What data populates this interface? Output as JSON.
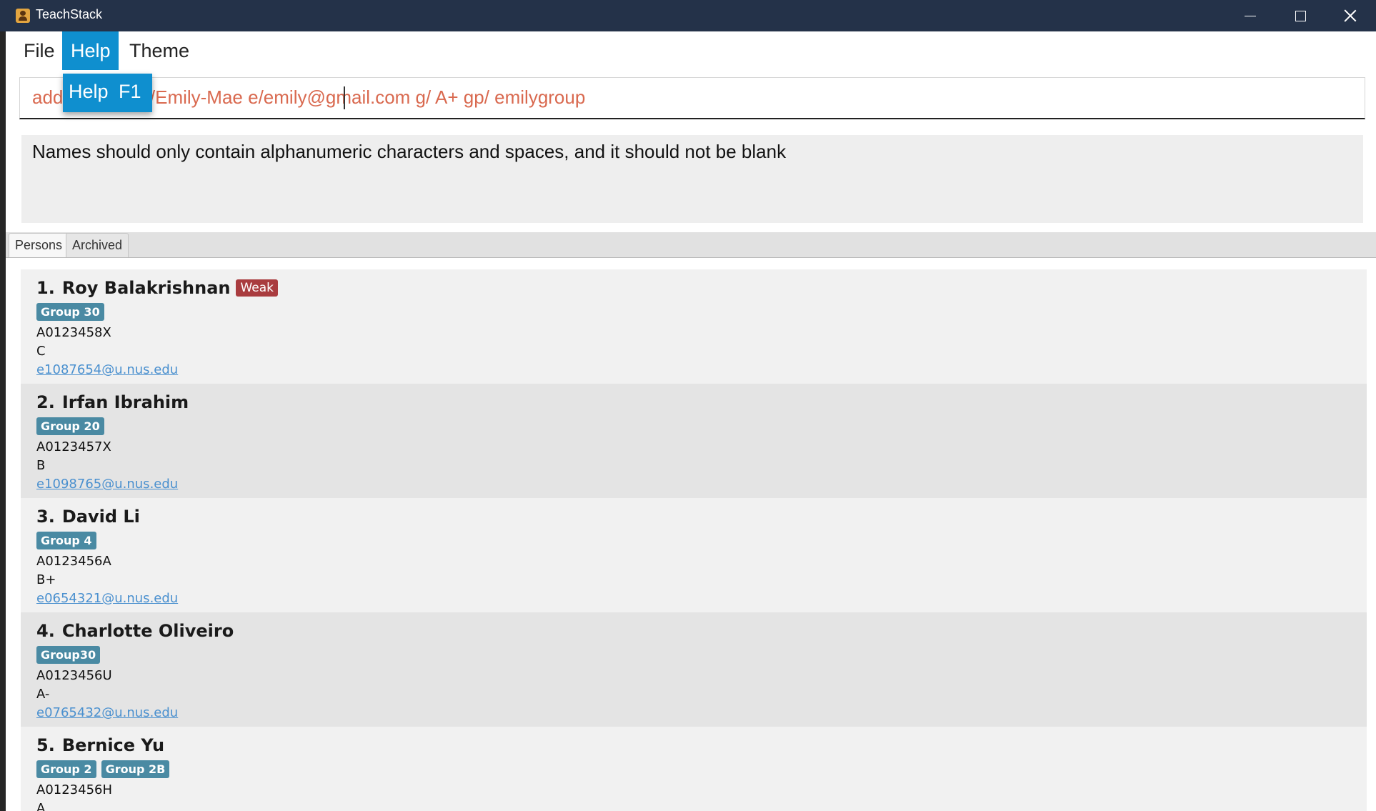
{
  "window": {
    "title": "TeachStack",
    "controls": [
      "minimize",
      "maximize",
      "close"
    ]
  },
  "menubar": {
    "items": [
      {
        "label": "File"
      },
      {
        "label": "Help"
      },
      {
        "label": "Theme"
      }
    ],
    "open_menu": {
      "item_label": "Help",
      "accelerator": "F1"
    }
  },
  "command_box": {
    "value_hidden_part": "add",
    "value_visible_rest": "6X n/Emily-Mae e/emily@gmail.com g/ A+ gp/ emilygroup"
  },
  "result_display": {
    "message": "Names should only contain alphanumeric characters and spaces, and it should not be blank"
  },
  "tabs": [
    {
      "label": "Persons",
      "selected": true
    },
    {
      "label": "Archived",
      "selected": false
    }
  ],
  "persons": [
    {
      "index": "1.",
      "name": "Roy Balakrishnan",
      "tag": "Weak",
      "groups": [
        "Group 30"
      ],
      "student_id": "A0123458X",
      "grade": "C",
      "email": "e1087654@u.nus.edu"
    },
    {
      "index": "2.",
      "name": "Irfan Ibrahim",
      "groups": [
        "Group 20"
      ],
      "student_id": "A0123457X",
      "grade": "B",
      "email": "e1098765@u.nus.edu"
    },
    {
      "index": "3.",
      "name": "David Li",
      "groups": [
        "Group 4"
      ],
      "student_id": "A0123456A",
      "grade": "B+",
      "email": "e0654321@u.nus.edu"
    },
    {
      "index": "4.",
      "name": "Charlotte Oliveiro",
      "groups": [
        "Group30"
      ],
      "student_id": "A0123456U",
      "grade": "A-",
      "email": "e0765432@u.nus.edu"
    },
    {
      "index": "5.",
      "name": "Bernice Yu",
      "groups": [
        "Group 2",
        "Group 2B"
      ],
      "student_id": "A0123456H",
      "grade": "A"
    }
  ],
  "colors": {
    "titlebar": "#243249",
    "menu_selected": "#0f8fcf",
    "command_text": "#d9694f",
    "weak_badge": "#a93c3f",
    "group_badge": "#4a8aa3",
    "email_link": "#4a90cf"
  }
}
